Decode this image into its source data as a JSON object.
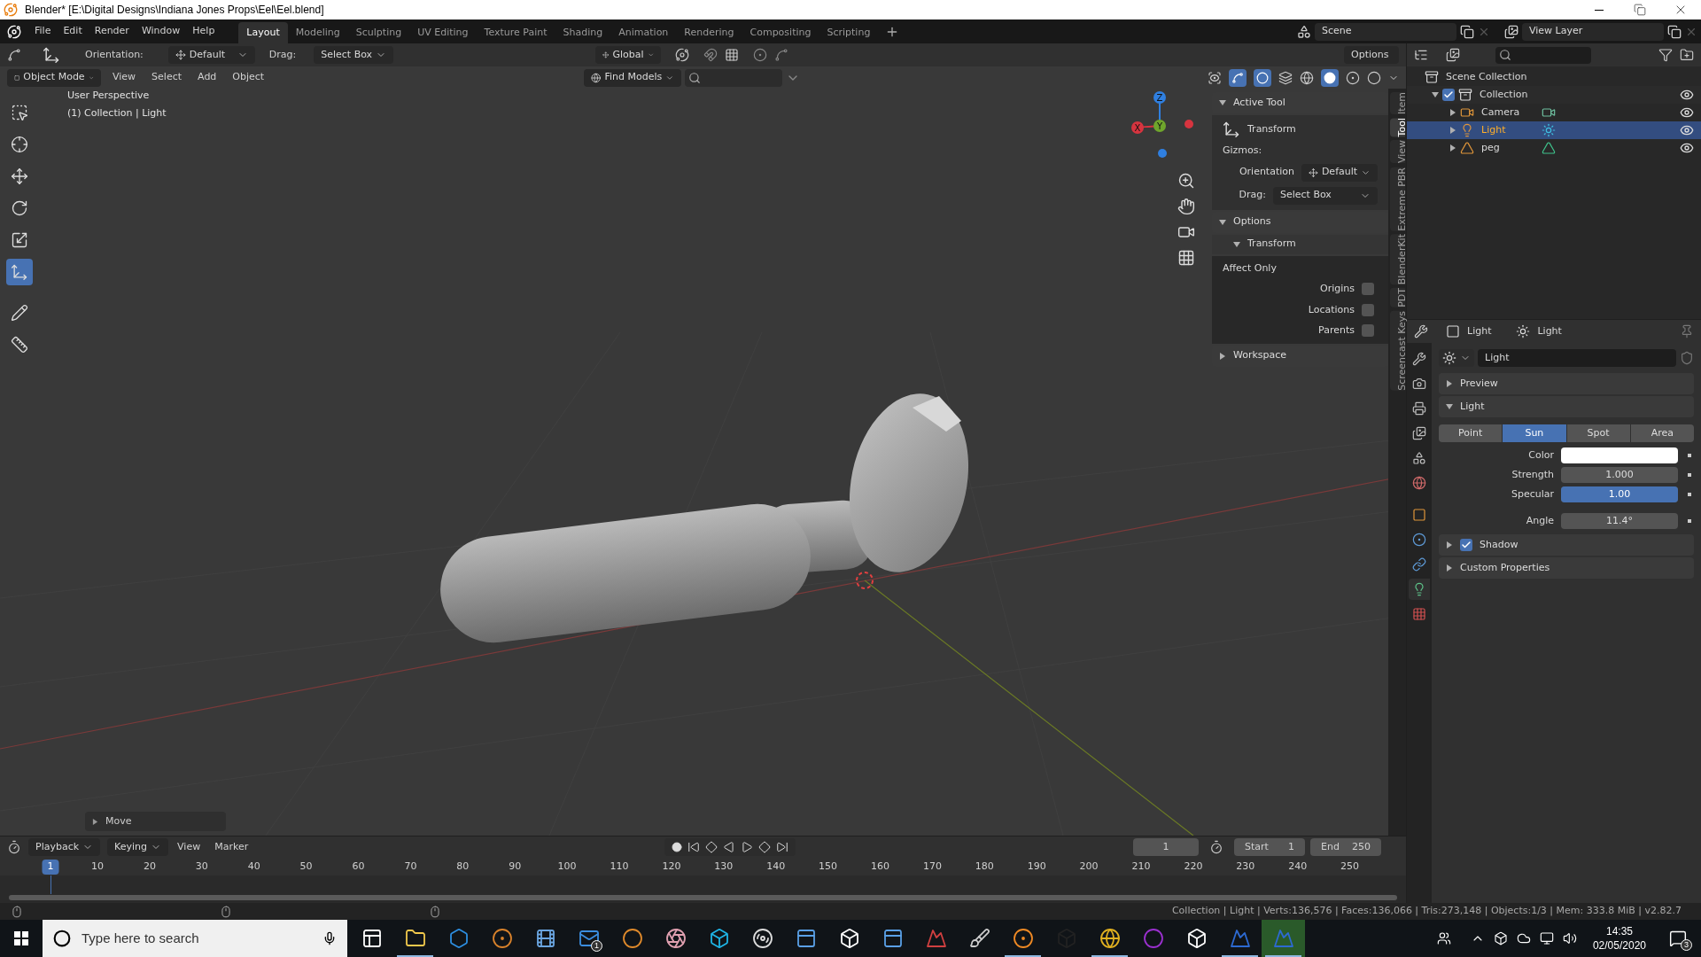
{
  "window": {
    "title": "Blender* [E:\\Digital Designs\\Indiana Jones Props\\Eel\\Eel.blend]"
  },
  "menu": [
    "File",
    "Edit",
    "Render",
    "Window",
    "Help"
  ],
  "workspaces": [
    {
      "label": "Layout",
      "selected": true
    },
    {
      "label": "Modeling",
      "selected": false
    },
    {
      "label": "Sculpting",
      "selected": false
    },
    {
      "label": "UV Editing",
      "selected": false
    },
    {
      "label": "Texture Paint",
      "selected": false
    },
    {
      "label": "Shading",
      "selected": false
    },
    {
      "label": "Animation",
      "selected": false
    },
    {
      "label": "Rendering",
      "selected": false
    },
    {
      "label": "Compositing",
      "selected": false
    },
    {
      "label": "Scripting",
      "selected": false
    }
  ],
  "scene": {
    "name": "Scene"
  },
  "view_layer": {
    "name": "View Layer"
  },
  "tool_settings": {
    "orientation_label": "Orientation:",
    "orientation": "Default",
    "drag_label": "Drag:",
    "drag": "Select Box",
    "transform_space": "Global",
    "options": "Options"
  },
  "viewport_header": {
    "mode": "Object Mode",
    "menus": [
      "View",
      "Select",
      "Add",
      "Object"
    ],
    "find_models": "Find Models"
  },
  "toolbar": [
    {
      "kind": "select",
      "selected": false
    },
    {
      "kind": "cursor",
      "selected": false
    },
    {
      "kind": "move",
      "selected": false
    },
    {
      "kind": "rotate",
      "selected": false
    },
    {
      "kind": "scale",
      "selected": false
    },
    {
      "kind": "transform",
      "selected": true
    },
    {
      "kind": "annotate",
      "selected": false
    },
    {
      "kind": "measure",
      "selected": false
    }
  ],
  "viewport": {
    "view_name": "User Perspective",
    "context": "(1) Collection | Light",
    "last_operator": "Move"
  },
  "gizmo": [
    {
      "label": "Z",
      "color": "#2f7fe0"
    },
    {
      "label": "X",
      "color": "#d6343f"
    },
    {
      "label": "Y",
      "color": "#6fa52c"
    }
  ],
  "sidebar": {
    "tabs": [
      {
        "label": "Item",
        "selected": false
      },
      {
        "label": "Tool",
        "selected": true
      },
      {
        "label": "View",
        "selected": false
      },
      {
        "label": "Extreme PBR",
        "selected": false
      },
      {
        "label": "BlenderKit",
        "selected": false
      },
      {
        "label": "PDT",
        "selected": false
      },
      {
        "label": "Screencast Keys",
        "selected": false
      }
    ],
    "active_tool": {
      "title": "Active Tool",
      "expanded": true,
      "tool": "Transform",
      "gizmos_label": "Gizmos:",
      "orientation_label": "Orientation",
      "orientation": "Default",
      "drag_label": "Drag:",
      "drag": "Select Box"
    },
    "options": {
      "title": "Options",
      "expanded": true,
      "subpanel": "Transform",
      "subpanel_expanded": true,
      "affect_only": "Affect Only",
      "checks": [
        {
          "label": "Origins",
          "checked": false
        },
        {
          "label": "Locations",
          "checked": false
        },
        {
          "label": "Parents",
          "checked": false
        }
      ]
    },
    "workspace": {
      "title": "Workspace",
      "expanded": false
    }
  },
  "outliner": {
    "root": "Scene Collection",
    "items": [
      {
        "label": "Collection",
        "kind": "collection",
        "checked": true,
        "expanded": true,
        "selected": false,
        "children": [
          {
            "label": "Camera",
            "kind": "camera",
            "expanded": false,
            "selected": false
          },
          {
            "label": "Light",
            "kind": "light",
            "expanded": false,
            "selected": true
          },
          {
            "label": "peg",
            "kind": "mesh",
            "expanded": false,
            "selected": false
          }
        ]
      }
    ]
  },
  "properties": {
    "tabs": [
      {
        "kind": "tool",
        "selected": false
      },
      {
        "kind": "render",
        "selected": false
      },
      {
        "kind": "output",
        "selected": false
      },
      {
        "kind": "view_layer",
        "selected": false
      },
      {
        "kind": "scene",
        "selected": false
      },
      {
        "kind": "world",
        "selected": false
      },
      {
        "kind": "object",
        "selected": false
      },
      {
        "kind": "physics",
        "selected": false
      },
      {
        "kind": "constraints",
        "selected": false
      },
      {
        "kind": "data",
        "selected": true
      },
      {
        "kind": "texture",
        "selected": false
      }
    ],
    "object": "Light",
    "data": "Light",
    "datablock": "Light",
    "preview": {
      "title": "Preview",
      "expanded": false
    },
    "light": {
      "title": "Light",
      "expanded": true,
      "types": [
        {
          "label": "Point",
          "selected": false
        },
        {
          "label": "Sun",
          "selected": true
        },
        {
          "label": "Spot",
          "selected": false
        },
        {
          "label": "Area",
          "selected": false
        }
      ],
      "fields": [
        {
          "kind": "color",
          "label": "Color",
          "color": "#ffffff"
        },
        {
          "kind": "number",
          "label": "Strength",
          "value": "1.000"
        },
        {
          "kind": "slider",
          "label": "Specular",
          "value": "1.00",
          "level": 1
        },
        {
          "kind": "number",
          "label": "Angle",
          "value": "11.4°"
        }
      ]
    },
    "shadow": {
      "title": "Shadow",
      "expanded": false,
      "checked": true
    },
    "custom_properties": {
      "title": "Custom Properties",
      "expanded": false
    }
  },
  "timeline": {
    "menus": [
      "Playback",
      "Keying",
      "View",
      "Marker"
    ],
    "current_frame": "1",
    "start_label": "Start",
    "start": "1",
    "end_label": "End",
    "end": "250",
    "ruler": [
      {
        "label": "1",
        "selected": true
      },
      {
        "label": "10",
        "selected": false
      },
      {
        "label": "20",
        "selected": false
      },
      {
        "label": "30",
        "selected": false
      },
      {
        "label": "40",
        "selected": false
      },
      {
        "label": "50",
        "selected": false
      },
      {
        "label": "60",
        "selected": false
      },
      {
        "label": "70",
        "selected": false
      },
      {
        "label": "80",
        "selected": false
      },
      {
        "label": "90",
        "selected": false
      },
      {
        "label": "100",
        "selected": false
      },
      {
        "label": "110",
        "selected": false
      },
      {
        "label": "120",
        "selected": false
      },
      {
        "label": "130",
        "selected": false
      },
      {
        "label": "140",
        "selected": false
      },
      {
        "label": "150",
        "selected": false
      },
      {
        "label": "160",
        "selected": false
      },
      {
        "label": "170",
        "selected": false
      },
      {
        "label": "180",
        "selected": false
      },
      {
        "label": "190",
        "selected": false
      },
      {
        "label": "200",
        "selected": false
      },
      {
        "label": "210",
        "selected": false
      },
      {
        "label": "220",
        "selected": false
      },
      {
        "label": "230",
        "selected": false
      },
      {
        "label": "240",
        "selected": false
      },
      {
        "label": "250",
        "selected": false
      }
    ]
  },
  "status_bar": "Collection | Light | Verts:136,576 | Faces:136,066 | Tris:273,148 | Objects:1/3 | Mem: 333.8 MiB | v2.82.7",
  "taskbar": {
    "search_placeholder": "Type here to search",
    "apps": [
      {
        "kind": "task_view",
        "color": "#ffffff",
        "open": false,
        "focused": false
      },
      {
        "kind": "folder",
        "color": "#f2c94c",
        "open": true,
        "focused": false
      },
      {
        "kind": "hexagon",
        "color": "#2d8ee0",
        "open": false,
        "focused": false
      },
      {
        "kind": "target",
        "color": "#d9822b",
        "open": false,
        "focused": false
      },
      {
        "kind": "film",
        "color": "#6aa5e0",
        "open": false,
        "focused": false
      },
      {
        "kind": "mail",
        "color": "#3b8ee0",
        "open": false,
        "focused": false,
        "badge": "1"
      },
      {
        "kind": "ball",
        "color": "#e08a2b",
        "open": false,
        "focused": false
      },
      {
        "kind": "aperture",
        "color": "#e0a0b0",
        "open": false,
        "focused": false
      },
      {
        "kind": "cube",
        "color": "#1fb5e6",
        "open": false,
        "focused": false
      },
      {
        "kind": "disc",
        "color": "#dddddd",
        "open": false,
        "focused": false
      },
      {
        "kind": "window",
        "color": "#5aa0e6",
        "open": false,
        "focused": false
      },
      {
        "kind": "cube",
        "color": "#ffffff",
        "open": false,
        "focused": false
      },
      {
        "kind": "window",
        "color": "#5aa0e6",
        "open": false,
        "focused": false
      },
      {
        "kind": "mountain",
        "color": "#d04040",
        "open": false,
        "focused": false
      },
      {
        "kind": "brush",
        "color": "#cccccc",
        "open": false,
        "focused": false
      },
      {
        "kind": "target",
        "color": "#f08a24",
        "open": true,
        "focused": false
      },
      {
        "kind": "cube",
        "color": "#222222",
        "open": false,
        "focused": false
      },
      {
        "kind": "globe",
        "color": "#e0b020",
        "open": true,
        "focused": false
      },
      {
        "kind": "ring",
        "color": "#9b30d0",
        "open": false,
        "focused": false
      },
      {
        "kind": "cube",
        "color": "#ffffff",
        "open": false,
        "focused": false
      },
      {
        "kind": "mountain",
        "color": "#2d6ad2",
        "open": true,
        "focused": false
      },
      {
        "kind": "mountain",
        "color": "#2d6ad2",
        "open": true,
        "focused": true
      }
    ],
    "time": "14:35",
    "date": "02/05/2020",
    "notifications": "3"
  }
}
